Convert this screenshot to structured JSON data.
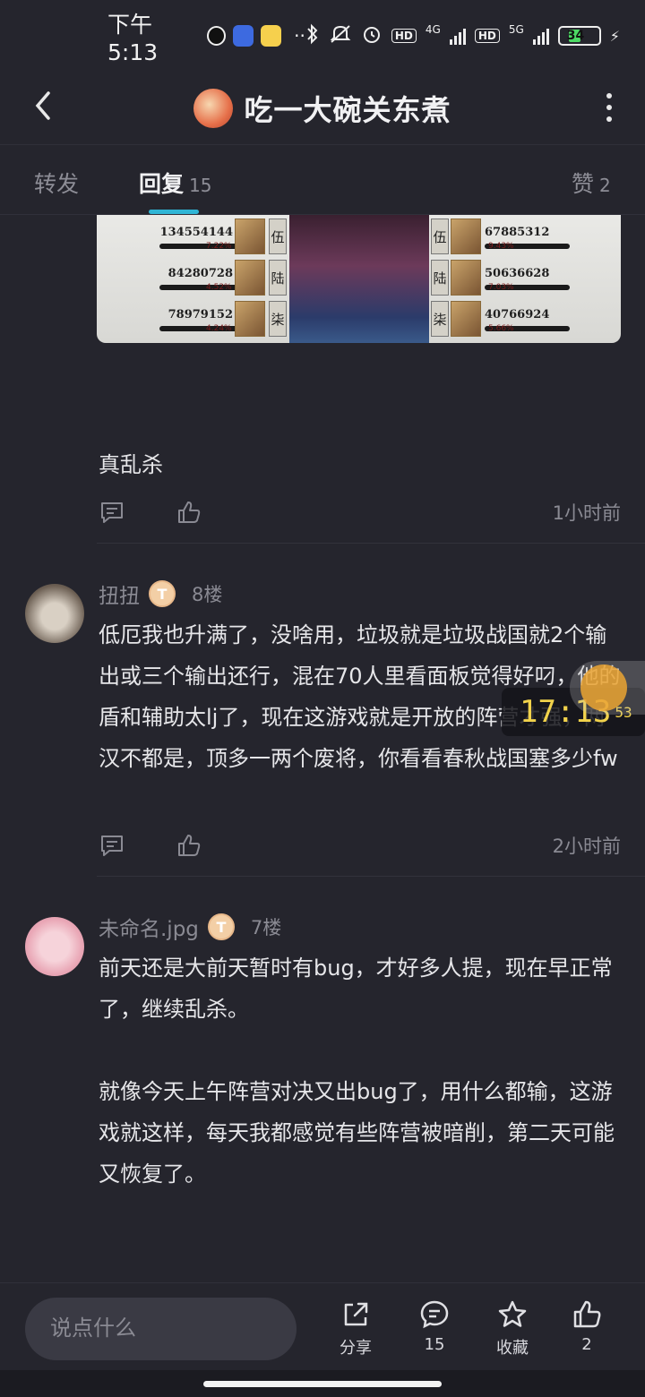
{
  "status_bar": {
    "time": "下午5:13",
    "network_4g": "4G",
    "network_5g": "5G",
    "hd1": "HD",
    "hd2": "HD",
    "battery": "34"
  },
  "header": {
    "title": "吃一大碗关东煮"
  },
  "tabs": [
    {
      "label": "转发",
      "count": ""
    },
    {
      "label": "回复",
      "count": "15"
    },
    {
      "label": "赞",
      "count": "2"
    }
  ],
  "image_card": {
    "left_rows": [
      {
        "value": "134554144",
        "pct": "7.22%",
        "tag": "伍"
      },
      {
        "value": "84280728",
        "pct": "4.52%",
        "tag": "陆"
      },
      {
        "value": "78979152",
        "pct": "4.24%",
        "tag": "柒"
      }
    ],
    "right_rows": [
      {
        "value": "67885312",
        "pct": "9.43%",
        "tag": "伍"
      },
      {
        "value": "50636628",
        "pct": "7.03%",
        "tag": "陆"
      },
      {
        "value": "40766924",
        "pct": "5.66%",
        "tag": "柒"
      }
    ]
  },
  "comments": [
    {
      "text": "真乱杀",
      "time": "1小时前"
    },
    {
      "user": "扭扭",
      "level": "T",
      "floor": "8楼",
      "text": "低厄我也升满了，没啥用，垃圾就是垃圾战国就2个输出或三个输出还行，混在70人里看面板觉得好叼，他的盾和辅助太lj了，现在这游戏就是开放的阵营才强，两汉不都是，顶多一两个废将，你看看春秋战国塞多少fw",
      "time": "2小时前"
    },
    {
      "user": "未命名.jpg",
      "level": "T",
      "floor": "7楼",
      "text_p1": "前天还是大前天暂时有bug，才好多人提，现在早正常了，继续乱杀。",
      "text_p2": "就像今天上午阵营对决又出bug了，用什么都输，这游戏就这样，每天我都感觉有些阵营被暗削，第二天可能又恢复了。"
    }
  ],
  "float_clock": {
    "hhmm": "17:13",
    "sec": "53"
  },
  "bottom_bar": {
    "placeholder": "说点什么",
    "share_label": "分享",
    "comment_count": "15",
    "favorite_label": "收藏",
    "like_count": "2"
  },
  "colors": {
    "background": "#25252d",
    "accent": "#2fb5d5",
    "clock": "#f1d24b"
  }
}
